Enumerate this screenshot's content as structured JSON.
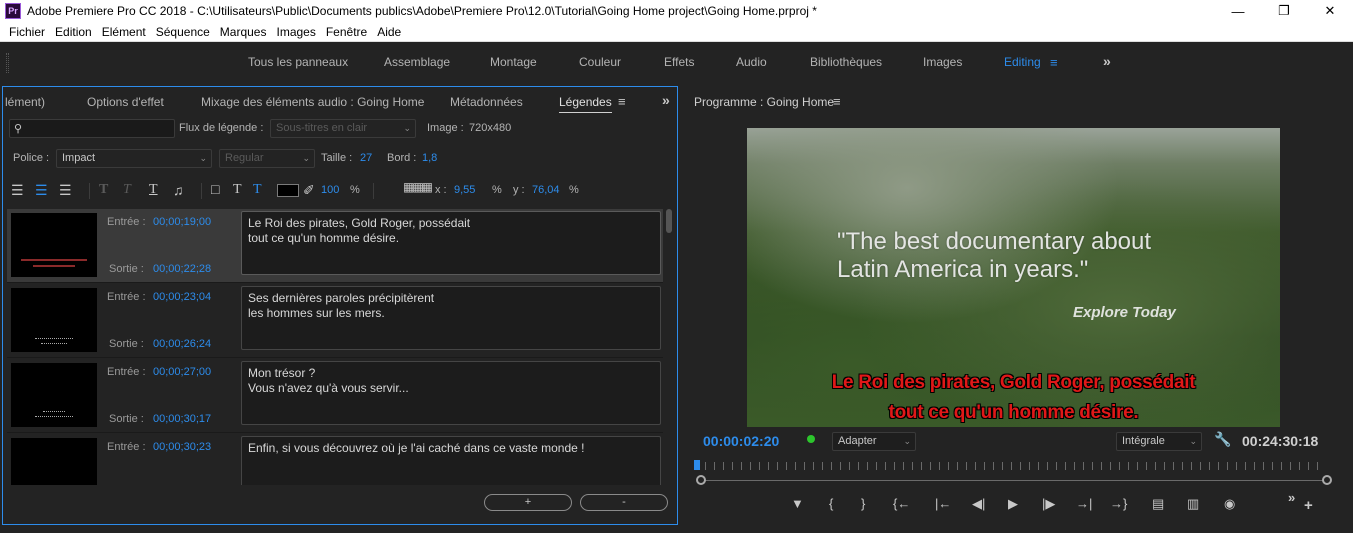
{
  "window": {
    "title": "Adobe Premiere Pro CC 2018 - C:\\Utilisateurs\\Public\\Documents publics\\Adobe\\Premiere Pro\\12.0\\Tutorial\\Going Home project\\Going Home.prproj *",
    "app_icon_label": "Pr"
  },
  "menu": [
    "Fichier",
    "Edition",
    "Elément",
    "Séquence",
    "Marques",
    "Images",
    "Fenêtre",
    "Aide"
  ],
  "workspaces": {
    "items": [
      "Tous les panneaux",
      "Assemblage",
      "Montage",
      "Couleur",
      "Effets",
      "Audio",
      "Bibliothèques",
      "Images",
      "Editing"
    ],
    "active": "Editing"
  },
  "left_panel": {
    "tabs": [
      "lément)",
      "Options d'effet",
      "Mixage des éléments audio : Going Home",
      "Métadonnées",
      "Légendes"
    ],
    "active_tab": "Légendes",
    "search": {
      "value": "",
      "placeholder": ""
    },
    "flux_label": "Flux de légende :",
    "flux_value": "Sous-titres en clair",
    "image_label": "Image :",
    "image_value": "720x480",
    "police_label": "Police :",
    "police_value": "Impact",
    "style_value": "Regular",
    "taille_label": "Taille :",
    "taille_value": "27",
    "bord_label": "Bord :",
    "bord_value": "1,8",
    "opacity_value": "100",
    "percent": "%",
    "x_label": "x :",
    "x_value": "9,55",
    "y_label": "y :",
    "y_value": "76,04",
    "captions": [
      {
        "in_label": "Entrée :",
        "in": "00;00;19;00",
        "out_label": "Sortie :",
        "out": "00;00;22;28",
        "text": "Le Roi des pirates, Gold Roger, possédait\ntout ce qu'un homme désire."
      },
      {
        "in_label": "Entrée :",
        "in": "00;00;23;04",
        "out_label": "Sortie :",
        "out": "00;00;26;24",
        "text": "Ses dernières paroles précipitèrent\nles hommes sur les mers."
      },
      {
        "in_label": "Entrée :",
        "in": "00;00;27;00",
        "out_label": "Sortie :",
        "out": "00;00;30;17",
        "text": "Mon trésor ?\nVous n'avez qu'à vous servir..."
      },
      {
        "in_label": "Entrée :",
        "in": "00;00;30;23",
        "out_label": "Sortie :",
        "out": "",
        "text": "Enfin, si vous découvrez où je l'ai caché dans ce vaste monde !"
      }
    ],
    "add_button": "+",
    "remove_button": "-"
  },
  "program": {
    "title": "Programme : Going Home",
    "video_quote": "\"The best documentary about\nLatin America in years.\"",
    "video_tagline": "Explore Today",
    "video_subtitle": "Le Roi des pirates, Gold Roger, possédait\ntout ce qu'un homme désire.",
    "timecode_current": "00:00:02:20",
    "fit_value": "Adapter",
    "quality_value": "Intégrale",
    "timecode_duration": "00:24:30:18"
  },
  "colors": {
    "accent": "#2d8ceb",
    "subtitle_red": "#e01818",
    "panel_bg": "#232323"
  }
}
